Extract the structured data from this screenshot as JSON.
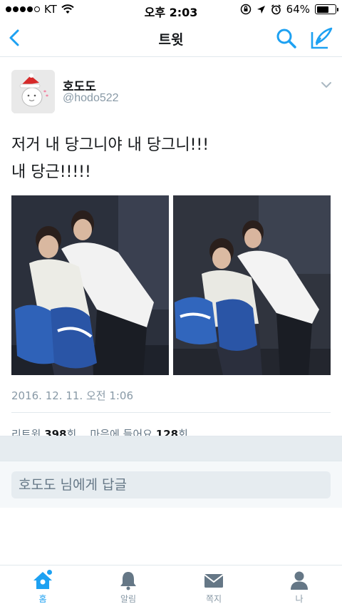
{
  "status_bar": {
    "carrier": "KT",
    "time": "오후 2:03",
    "battery_percent_label": "64%",
    "battery_level": 0.64
  },
  "nav": {
    "title": "트윗"
  },
  "tweet": {
    "display_name": "호도도",
    "handle": "@hodo522",
    "text_line1": "저거 내 당그니야 내 당그니!!!",
    "text_line2": "내 당근!!!!!",
    "timestamp": "2016. 12. 11. 오전 1:06",
    "retweet_label": "리트윗",
    "retweet_count": "398",
    "retweet_unit": "회",
    "like_label": "마음에 들어요",
    "like_count": "128",
    "like_unit": "회"
  },
  "reply": {
    "placeholder": "호도도 님에게 답글"
  },
  "tabs": [
    {
      "label": "홈",
      "icon": "home-icon",
      "active": true
    },
    {
      "label": "알림",
      "icon": "bell-icon",
      "active": false
    },
    {
      "label": "쪽지",
      "icon": "envelope-icon",
      "active": false
    },
    {
      "label": "나",
      "icon": "person-icon",
      "active": false
    }
  ],
  "colors": {
    "accent": "#1da1f2",
    "retweet_green": "#17bf63",
    "icon_gray": "#657786"
  }
}
